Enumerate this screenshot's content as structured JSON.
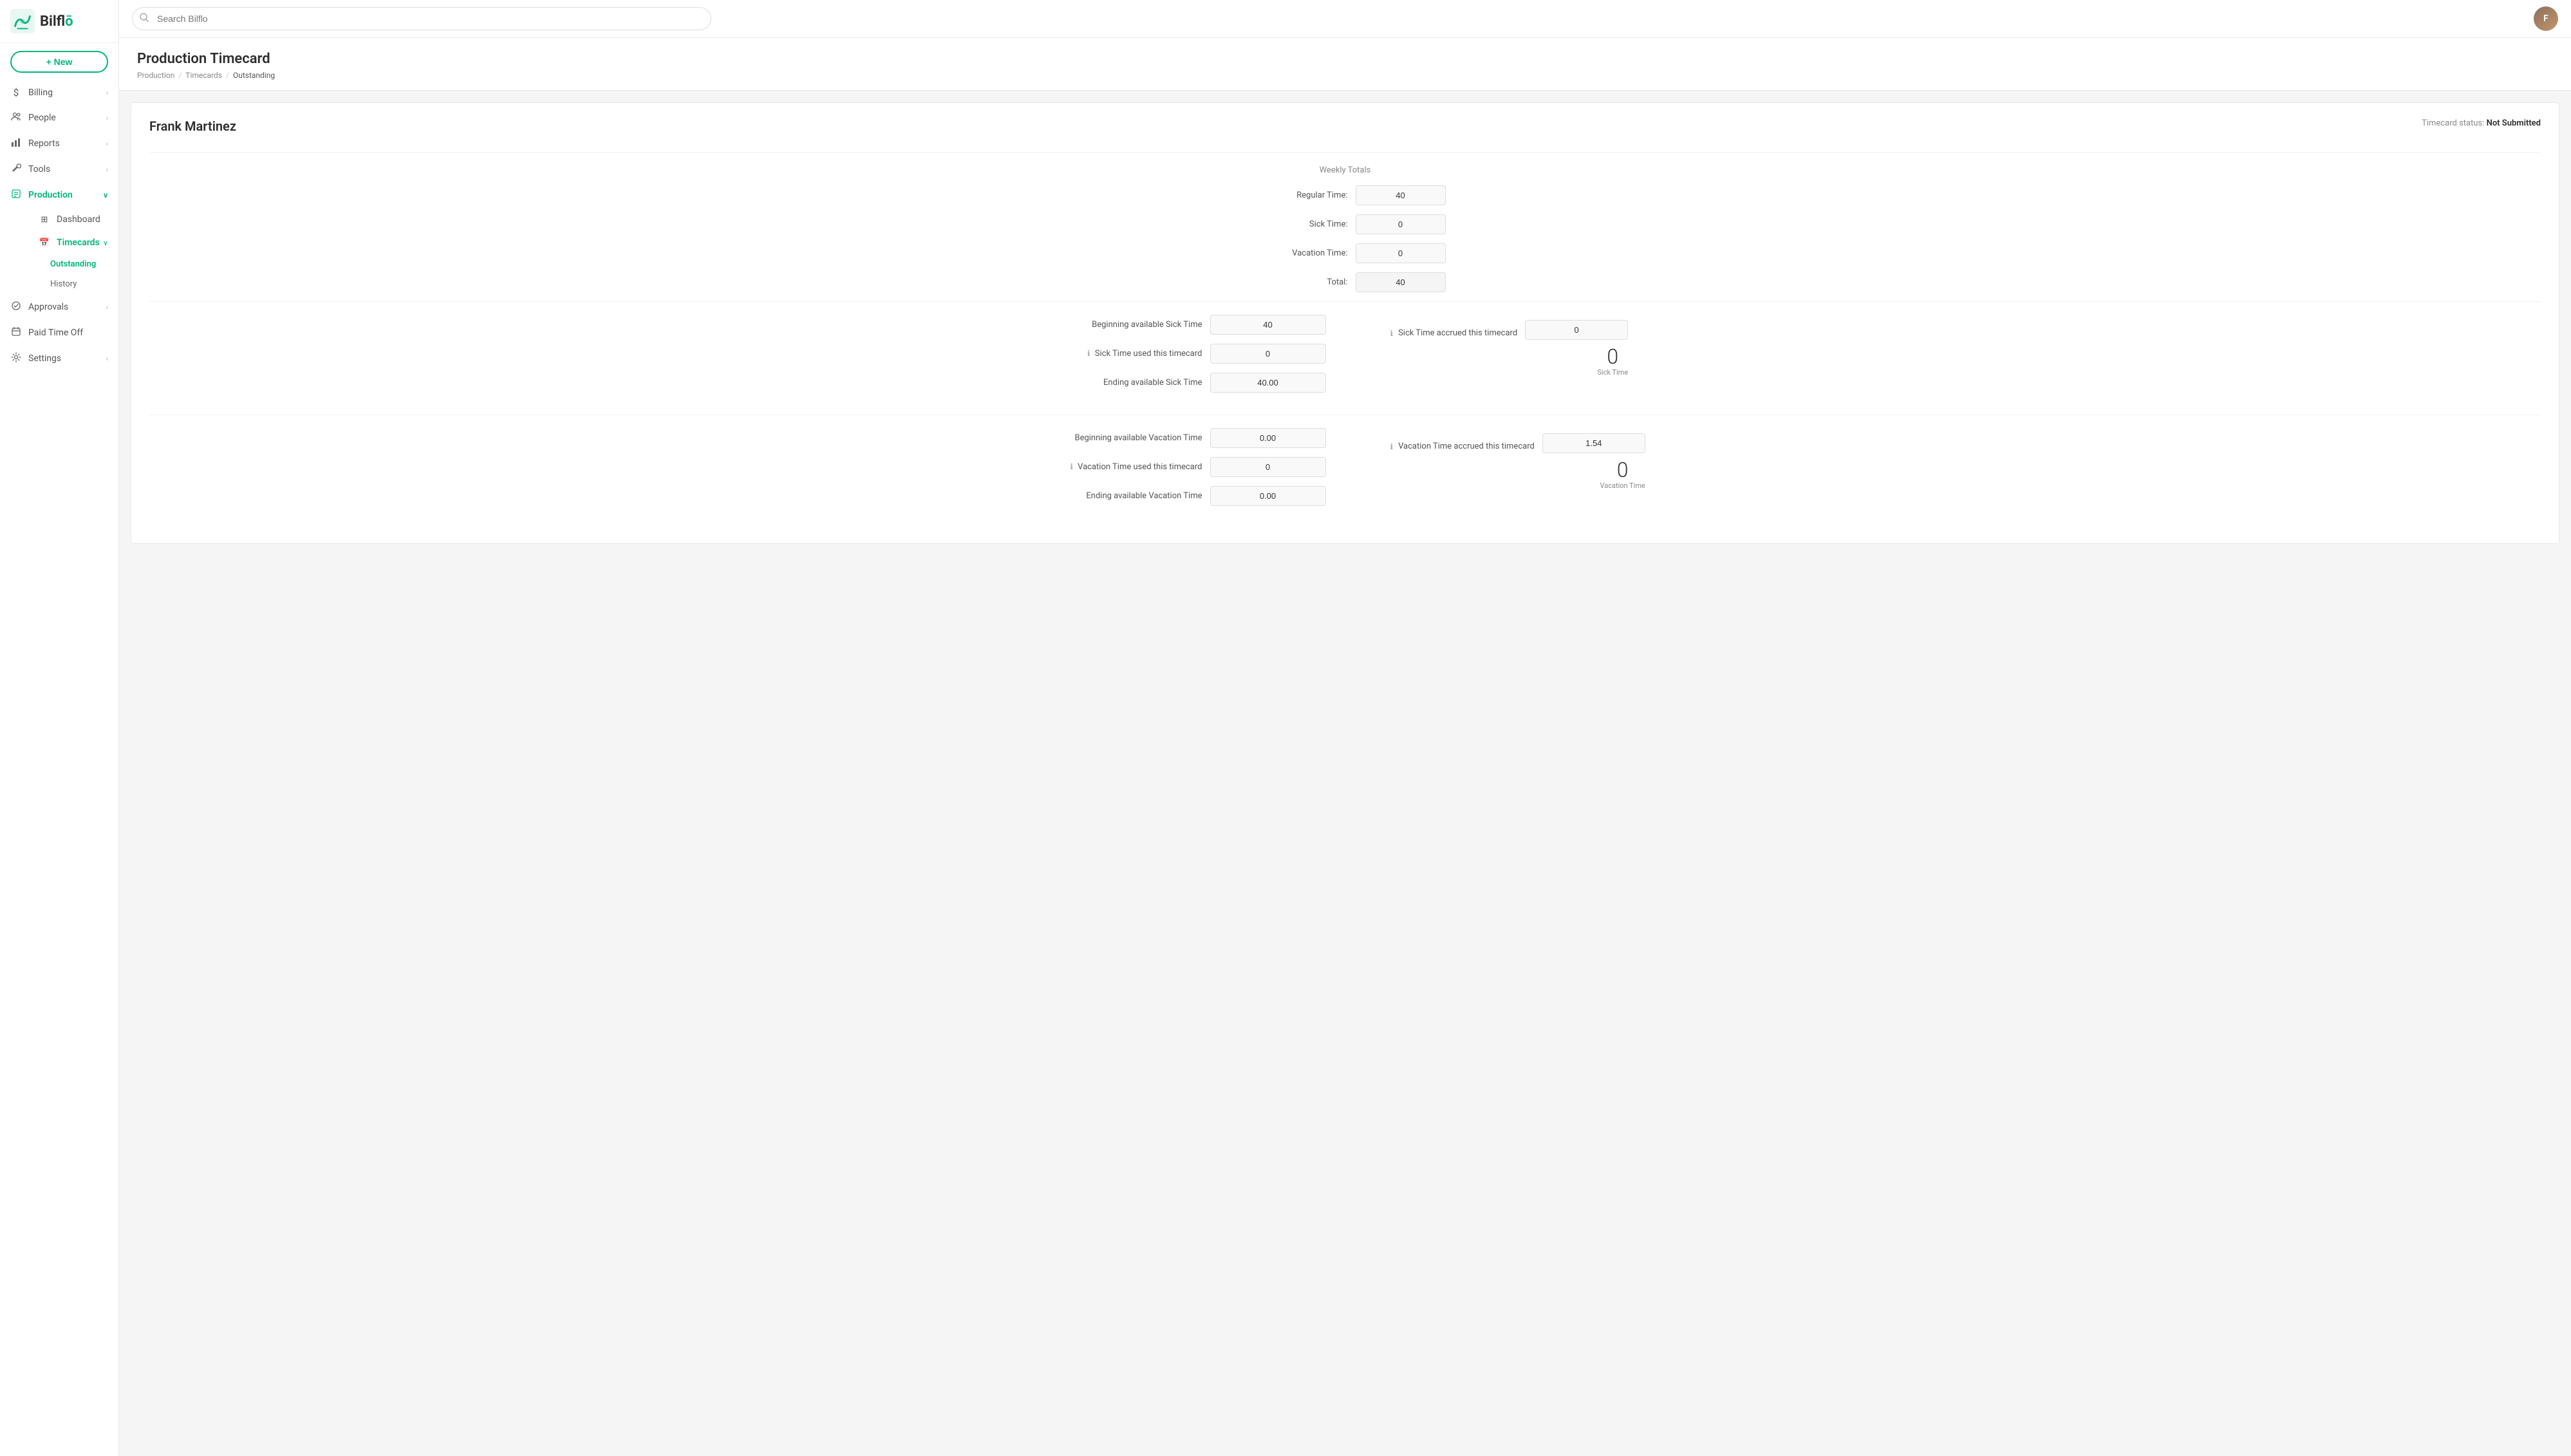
{
  "app": {
    "name": "Bilflo",
    "logo_text": "Bilfl",
    "logo_accent": "ō"
  },
  "topbar": {
    "search_placeholder": "Search Bilflo"
  },
  "new_button": "+ New",
  "sidebar": {
    "items": [
      {
        "id": "billing",
        "label": "Billing",
        "icon": "$",
        "has_chevron": true,
        "active": false
      },
      {
        "id": "people",
        "label": "People",
        "icon": "👥",
        "has_chevron": true,
        "active": false
      },
      {
        "id": "reports",
        "label": "Reports",
        "icon": "📊",
        "has_chevron": true,
        "active": false
      },
      {
        "id": "tools",
        "label": "Tools",
        "icon": "🔧",
        "has_chevron": true,
        "active": false
      },
      {
        "id": "production",
        "label": "Production",
        "icon": "📋",
        "has_chevron": true,
        "active": true
      },
      {
        "id": "approvals",
        "label": "Approvals",
        "icon": "✓",
        "has_chevron": true,
        "active": false
      },
      {
        "id": "paid_time_off",
        "label": "Paid Time Off",
        "icon": "📅",
        "has_chevron": false,
        "active": false
      },
      {
        "id": "settings",
        "label": "Settings",
        "icon": "⚙",
        "has_chevron": true,
        "active": false
      }
    ],
    "production_sub": [
      {
        "id": "dashboard",
        "label": "Dashboard",
        "active": false
      },
      {
        "id": "timecards",
        "label": "Timecards",
        "active": true,
        "has_chevron": true
      },
      {
        "id": "outstanding",
        "label": "Outstanding",
        "active": true,
        "indent": true
      },
      {
        "id": "history",
        "label": "History",
        "active": false,
        "indent": true
      }
    ]
  },
  "page": {
    "title": "Production Timecard",
    "breadcrumb": [
      {
        "label": "Production",
        "link": true
      },
      {
        "label": "Timecards",
        "link": true
      },
      {
        "label": "Outstanding",
        "link": false
      }
    ]
  },
  "worker": {
    "name": "Frank Martinez",
    "timecard_status_label": "Timecard status:",
    "timecard_status_value": "Not Submitted"
  },
  "weekly_totals": {
    "section_title": "Weekly Totals",
    "regular_time_label": "Regular Time:",
    "regular_time_value": "40",
    "sick_time_label": "Sick Time:",
    "sick_time_value": "0",
    "vacation_time_label": "Vacation Time:",
    "vacation_time_value": "0",
    "total_label": "Total:",
    "total_value": "40"
  },
  "sick_time": {
    "beginning_label": "Beginning available Sick Time",
    "beginning_value": "40",
    "used_label": "Sick Time used this timecard",
    "used_value": "0",
    "ending_label": "Ending available Sick Time",
    "ending_value": "40.00",
    "accrued_label": "Sick Time accrued this timecard",
    "accrued_value": "0",
    "big_number": "0",
    "big_label": "Sick Time"
  },
  "vacation_time": {
    "beginning_label": "Beginning available Vacation Time",
    "beginning_value": "0.00",
    "used_label": "Vacation Time used this timecard",
    "used_value": "0",
    "ending_label": "Ending available Vacation Time",
    "ending_value": "0.00",
    "accrued_label": "Vacation Time accrued this timecard",
    "accrued_value": "1.54",
    "big_number": "0",
    "big_label": "Vacation Time"
  }
}
